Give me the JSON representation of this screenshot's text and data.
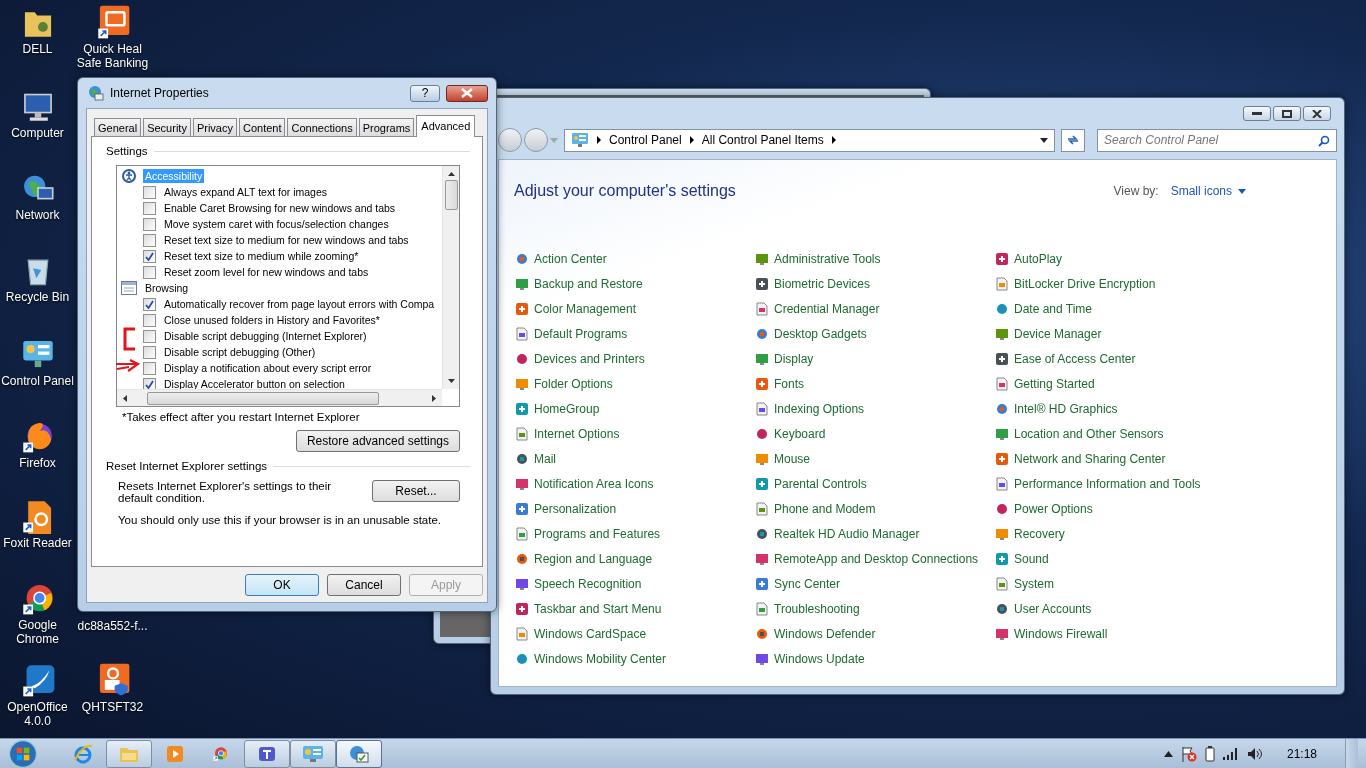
{
  "desktop_icons": [
    {
      "label": "DELL"
    },
    {
      "label": "Computer"
    },
    {
      "label": "Network"
    },
    {
      "label": "Recycle Bin"
    },
    {
      "label": "Control Panel"
    },
    {
      "label": "Firefox"
    },
    {
      "label": "Foxit Reader"
    },
    {
      "label": "Google Chrome"
    },
    {
      "label": "OpenOffice 4.0.0"
    },
    {
      "label": "Quick Heal Safe Banking"
    },
    {
      "label": "dc88a552-f..."
    },
    {
      "label": "QHTSFT32"
    }
  ],
  "control_panel": {
    "breadcrumbs": [
      "Control Panel",
      "All Control Panel Items"
    ],
    "search": {
      "placeholder": "Search Control Panel"
    },
    "heading": "Adjust your computer's settings",
    "view_by": {
      "label": "View by:",
      "value": "Small icons"
    },
    "items": [
      "Action Center",
      "Backup and Restore",
      "Color Management",
      "Default Programs",
      "Devices and Printers",
      "Folder Options",
      "HomeGroup",
      "Internet Options",
      "Mail",
      "Notification Area Icons",
      "Personalization",
      "Programs and Features",
      "Region and Language",
      "Speech Recognition",
      "Taskbar and Start Menu",
      "Windows CardSpace",
      "Windows Mobility Center",
      "Administrative Tools",
      "Biometric Devices",
      "Credential Manager",
      "Desktop Gadgets",
      "Display",
      "Fonts",
      "Indexing Options",
      "Keyboard",
      "Mouse",
      "Parental Controls",
      "Phone and Modem",
      "Realtek HD Audio Manager",
      "RemoteApp and Desktop Connections",
      "Sync Center",
      "Troubleshooting",
      "Windows Defender",
      "Windows Update",
      "AutoPlay",
      "BitLocker Drive Encryption",
      "Date and Time",
      "Device Manager",
      "Ease of Access Center",
      "Getting Started",
      "Intel® HD Graphics",
      "Location and Other Sensors",
      "Network and Sharing Center",
      "Performance Information and Tools",
      "Power Options",
      "Recovery",
      "Sound",
      "System",
      "User Accounts",
      "Windows Firewall"
    ]
  },
  "dialog": {
    "title": "Internet Properties",
    "help": "?",
    "tabs": [
      {
        "label": "General",
        "selected": false
      },
      {
        "label": "Security",
        "selected": false
      },
      {
        "label": "Privacy",
        "selected": false
      },
      {
        "label": "Content",
        "selected": false
      },
      {
        "label": "Connections",
        "selected": false
      },
      {
        "label": "Programs",
        "selected": false
      },
      {
        "label": "Advanced",
        "selected": true
      }
    ],
    "settings_label": "Settings",
    "tree": [
      {
        "kind": "category",
        "label": "Accessibility",
        "selected": true
      },
      {
        "kind": "option",
        "label": "Always expand ALT text for images",
        "checked": false
      },
      {
        "kind": "option",
        "label": "Enable Caret Browsing for new windows and tabs",
        "checked": false
      },
      {
        "kind": "option",
        "label": "Move system caret with focus/selection changes",
        "checked": false
      },
      {
        "kind": "option",
        "label": "Reset text size to medium for new windows and tabs",
        "checked": false
      },
      {
        "kind": "option",
        "label": "Reset text size to medium while zooming*",
        "checked": true
      },
      {
        "kind": "option",
        "label": "Reset zoom level for new windows and tabs",
        "checked": false
      },
      {
        "kind": "category",
        "label": "Browsing",
        "selected": false
      },
      {
        "kind": "option",
        "label": "Automatically recover from page layout errors with Compa",
        "checked": true
      },
      {
        "kind": "option",
        "label": "Close unused folders in History and Favorites*",
        "checked": false
      },
      {
        "kind": "option",
        "label": "Disable script debugging (Internet Explorer)",
        "checked": false
      },
      {
        "kind": "option",
        "label": "Disable script debugging (Other)",
        "checked": false
      },
      {
        "kind": "option",
        "label": "Display a notification about every script error",
        "checked": false
      },
      {
        "kind": "option",
        "label": "Display Accelerator button on selection",
        "checked": true
      }
    ],
    "note": "*Takes effect after you restart Internet Explorer",
    "restore_button": "Restore advanced settings",
    "reset_group": "Reset Internet Explorer settings",
    "reset_text": "Resets Internet Explorer's settings to their default condition.",
    "reset_button": "Reset...",
    "warning": "You should only use this if your browser is in an unusable state.",
    "buttons": [
      {
        "label": "OK",
        "disabled": false
      },
      {
        "label": "Cancel",
        "disabled": false
      },
      {
        "label": "Apply",
        "disabled": true
      }
    ]
  },
  "taskbar": {
    "clock": "21:18"
  }
}
